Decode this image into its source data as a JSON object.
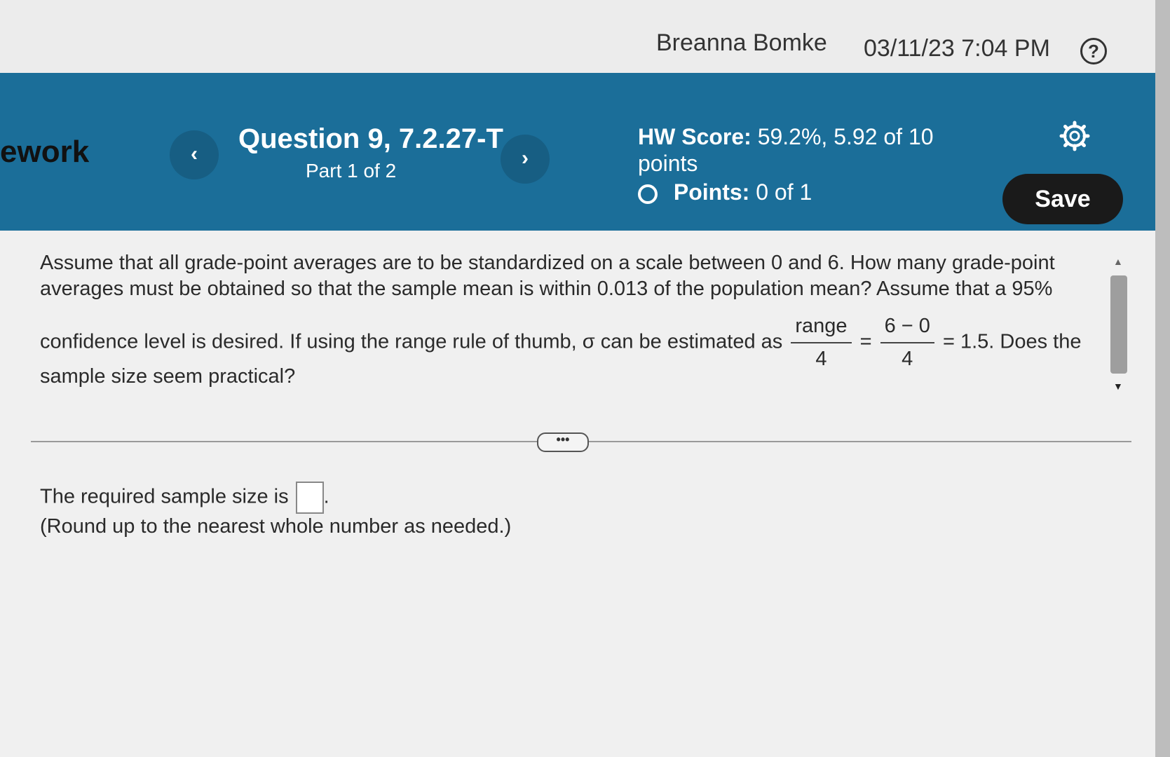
{
  "header": {
    "user_name": "Breanna Bomke",
    "timestamp": "03/11/23 7:04 PM",
    "help_label": "?"
  },
  "nav": {
    "app_title": "ework",
    "prev_label": "‹",
    "next_label": "›",
    "question_title": "Question 9, 7.2.27-T",
    "question_part": "Part 1 of 2",
    "hw_score_label": "HW Score:",
    "hw_score_value": "59.2%, 5.92 of 10 points",
    "points_label": "Points:",
    "points_value": "0 of 1",
    "save_label": "Save"
  },
  "question": {
    "line1": "Assume that all grade-point averages are to be standardized on a scale between 0 and 6. How many grade-point averages must be obtained so that the sample mean is within 0.013 of the population mean? Assume that a 95%",
    "line2_pre": "confidence level is desired. If using the range rule of thumb, σ can be estimated as",
    "frac1_num": "range",
    "frac1_den": "4",
    "eq1": "=",
    "frac2_num": "6 − 0",
    "frac2_den": "4",
    "line2_post": "= 1.5. Does the",
    "line3": "sample size seem practical?"
  },
  "more_label": "•••",
  "answer": {
    "prompt": "The required sample size is",
    "hint": "(Round up to the nearest whole number as needed.)"
  }
}
